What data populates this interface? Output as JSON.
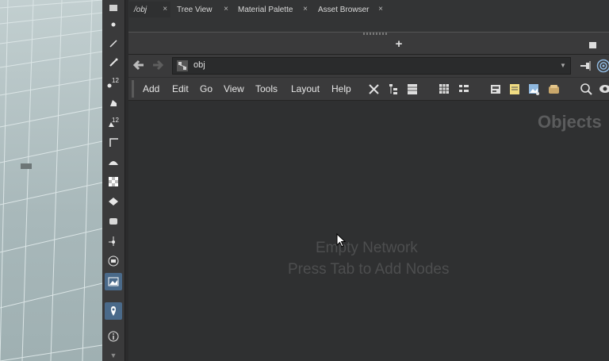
{
  "shelf": {
    "tools": [
      {
        "name": "move-tool-icon",
        "label": ""
      },
      {
        "name": "point-tool-icon",
        "label": ""
      },
      {
        "name": "edit-tool-icon",
        "label": ""
      },
      {
        "name": "brush-tool-icon",
        "label": ""
      },
      {
        "name": "handle-12-icon",
        "label": "12"
      },
      {
        "name": "pose-tool-icon",
        "label": ""
      },
      {
        "name": "handle-12b-icon",
        "label": "12"
      },
      {
        "name": "curve-tool-icon",
        "label": ""
      },
      {
        "name": "sculpt-tool-icon",
        "label": ""
      },
      {
        "name": "checker-icon",
        "label": ""
      },
      {
        "name": "layer-icon",
        "label": ""
      },
      {
        "name": "bone-icon",
        "label": ""
      },
      {
        "name": "light-icon",
        "label": ""
      },
      {
        "name": "list-icon",
        "label": ""
      },
      {
        "name": "image-icon",
        "label": ""
      },
      {
        "name": "pin-icon",
        "label": ""
      },
      {
        "name": "info-icon",
        "label": ""
      }
    ]
  },
  "tabs": [
    {
      "label": "/obj",
      "active": true
    },
    {
      "label": "Tree View",
      "active": false
    },
    {
      "label": "Material Palette",
      "active": false
    },
    {
      "label": "Asset Browser",
      "active": false
    }
  ],
  "tab_close": "×",
  "tab_add": "+",
  "path": {
    "value": "obj",
    "dropdown": "▼"
  },
  "menus": [
    "Add",
    "Edit",
    "Go",
    "View",
    "Tools",
    "Layout",
    "Help"
  ],
  "network": {
    "context_title": "Objects",
    "empty_line1": "Empty Network",
    "empty_line2": "Press Tab to Add Nodes"
  },
  "colors": {
    "accent": "#4a6a8a",
    "background": "#2f3031",
    "panel": "#3a3a3b"
  }
}
